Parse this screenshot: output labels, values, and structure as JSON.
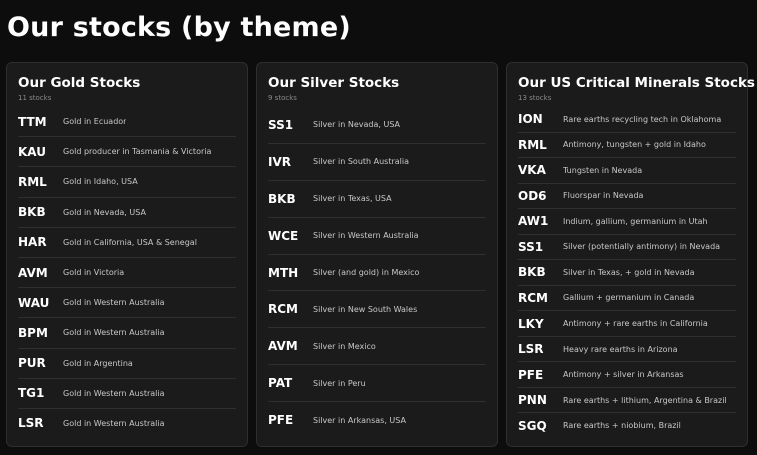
{
  "page": {
    "title": "Our stocks (by theme)"
  },
  "panels": [
    {
      "title": "Our Gold Stocks",
      "count": "11 stocks",
      "rows": [
        {
          "ticker": "TTM",
          "desc": "Gold in Ecuador"
        },
        {
          "ticker": "KAU",
          "desc": "Gold producer in Tasmania & Victoria"
        },
        {
          "ticker": "RML",
          "desc": "Gold in Idaho, USA"
        },
        {
          "ticker": "BKB",
          "desc": "Gold in Nevada, USA"
        },
        {
          "ticker": "HAR",
          "desc": "Gold in California, USA & Senegal"
        },
        {
          "ticker": "AVM",
          "desc": "Gold in Victoria"
        },
        {
          "ticker": "WAU",
          "desc": "Gold in Western Australia"
        },
        {
          "ticker": "BPM",
          "desc": "Gold in Western Australia"
        },
        {
          "ticker": "PUR",
          "desc": "Gold in Argentina"
        },
        {
          "ticker": "TG1",
          "desc": "Gold in Western Australia"
        },
        {
          "ticker": "LSR",
          "desc": "Gold in Western Australia"
        }
      ]
    },
    {
      "title": "Our Silver Stocks",
      "count": "9 stocks",
      "rows": [
        {
          "ticker": "SS1",
          "desc": "Silver in Nevada, USA"
        },
        {
          "ticker": "IVR",
          "desc": "Silver in South Australia"
        },
        {
          "ticker": "BKB",
          "desc": "Silver in Texas, USA"
        },
        {
          "ticker": "WCE",
          "desc": "Silver in Western Australia"
        },
        {
          "ticker": "MTH",
          "desc": "Silver (and gold) in Mexico"
        },
        {
          "ticker": "RCM",
          "desc": "Silver in New South Wales"
        },
        {
          "ticker": "AVM",
          "desc": "Silver in Mexico"
        },
        {
          "ticker": "PAT",
          "desc": "Silver in Peru"
        },
        {
          "ticker": "PFE",
          "desc": "Silver in Arkansas, USA"
        }
      ]
    },
    {
      "title": "Our US Critical Minerals Stocks",
      "count": "13 stocks",
      "rows": [
        {
          "ticker": "ION",
          "desc": "Rare earths recycling tech in Oklahoma"
        },
        {
          "ticker": "RML",
          "desc": "Antimony, tungsten + gold in Idaho"
        },
        {
          "ticker": "VKA",
          "desc": "Tungsten in Nevada"
        },
        {
          "ticker": "OD6",
          "desc": "Fluorspar in Nevada"
        },
        {
          "ticker": "AW1",
          "desc": "Indium, gallium, germanium in Utah"
        },
        {
          "ticker": "SS1",
          "desc": "Silver (potentially antimony) in Nevada"
        },
        {
          "ticker": "BKB",
          "desc": "Silver in Texas, + gold in Nevada"
        },
        {
          "ticker": "RCM",
          "desc": "Gallium + germanium in Canada"
        },
        {
          "ticker": "LKY",
          "desc": "Antimony + rare earths in California"
        },
        {
          "ticker": "LSR",
          "desc": "Heavy rare earths in Arizona"
        },
        {
          "ticker": "PFE",
          "desc": "Antimony + silver in Arkansas"
        },
        {
          "ticker": "PNN",
          "desc": "Rare earths + lithium, Argentina & Brazil"
        },
        {
          "ticker": "SGQ",
          "desc": "Rare earths + niobium, Brazil"
        }
      ]
    }
  ]
}
